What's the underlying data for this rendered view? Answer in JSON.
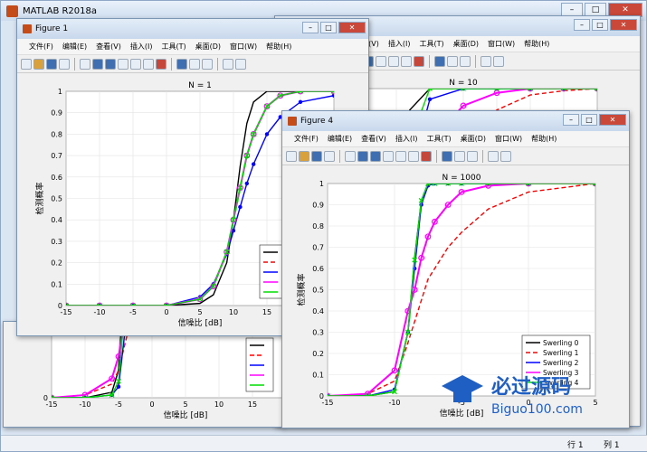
{
  "app": {
    "title": "MATLAB R2018a"
  },
  "status": {
    "row": "行 1",
    "col": "列 1"
  },
  "menus": [
    "文件(F)",
    "编辑(E)",
    "查看(V)",
    "插入(I)",
    "工具(T)",
    "桌面(D)",
    "窗口(W)",
    "帮助(H)"
  ],
  "fig1": {
    "title": "Figure 1"
  },
  "fig4": {
    "title": "Figure 4"
  },
  "watermark": {
    "main": "必过源码",
    "url": "Biguo100.com"
  },
  "colors": {
    "s0": "#000000",
    "s1": "#ff0000",
    "s2": "#0000ff",
    "s3": "#ff00ff",
    "s4": "#00dd00"
  },
  "chart_data": [
    {
      "type": "line",
      "title": "N = 1",
      "xlabel": "信噪比 [dB]",
      "ylabel": "检测概率",
      "xlim": [
        -15,
        25
      ],
      "ylim": [
        0,
        1
      ],
      "grid": true,
      "legend": "bottom-right",
      "x": [
        -15,
        -10,
        -5,
        0,
        5,
        7,
        9,
        10,
        11,
        12,
        13,
        15,
        17,
        20,
        25
      ],
      "series": [
        {
          "values": [
            0,
            0,
            0,
            0,
            0.01,
            0.05,
            0.2,
            0.4,
            0.65,
            0.85,
            0.95,
            1,
            1,
            1,
            1
          ]
        },
        {
          "values": [
            0,
            0,
            0,
            0,
            0.03,
            0.09,
            0.25,
            0.4,
            0.55,
            0.7,
            0.8,
            0.93,
            0.98,
            1,
            1
          ]
        },
        {
          "values": [
            0,
            0,
            0,
            0,
            0.04,
            0.1,
            0.24,
            0.35,
            0.46,
            0.57,
            0.66,
            0.8,
            0.88,
            0.95,
            0.98
          ]
        },
        {
          "values": [
            0,
            0,
            0,
            0,
            0.03,
            0.09,
            0.25,
            0.4,
            0.55,
            0.7,
            0.8,
            0.93,
            0.98,
            1,
            1
          ]
        },
        {
          "values": [
            0,
            0,
            0,
            0,
            0.03,
            0.09,
            0.25,
            0.4,
            0.55,
            0.7,
            0.8,
            0.93,
            0.98,
            1,
            1
          ]
        }
      ]
    },
    {
      "type": "line",
      "title": "N = 10",
      "xlabel": "信噪比 [dB]",
      "ylabel": "检测概率",
      "xlim": [
        -15,
        25
      ],
      "ylim": [
        0,
        1
      ],
      "grid": true,
      "legend": "bottom-right",
      "x": [
        -15,
        -10,
        -6,
        -5,
        -4,
        -3,
        0,
        5,
        10,
        15,
        20,
        25
      ],
      "series": [
        {
          "values": [
            0,
            0,
            0.02,
            0.1,
            0.5,
            0.9,
            1,
            1,
            1,
            1,
            1,
            1
          ]
        },
        {
          "values": [
            0,
            0.01,
            0.05,
            0.1,
            0.2,
            0.3,
            0.55,
            0.75,
            0.9,
            0.97,
            0.99,
            1
          ]
        },
        {
          "values": [
            0,
            0,
            0.01,
            0.04,
            0.25,
            0.6,
            0.95,
            1,
            1,
            1,
            1,
            1
          ]
        },
        {
          "values": [
            0,
            0.01,
            0.07,
            0.15,
            0.3,
            0.45,
            0.75,
            0.92,
            0.98,
            1,
            1,
            1
          ]
        },
        {
          "values": [
            0,
            0,
            0.01,
            0.06,
            0.35,
            0.75,
            1,
            1,
            1,
            1,
            1,
            1
          ]
        }
      ]
    },
    {
      "type": "line",
      "title": "N = 1000",
      "xlabel": "信噪比 [dB]",
      "ylabel": "检测概率",
      "xlim": [
        -15,
        5
      ],
      "ylim": [
        0,
        1
      ],
      "grid": true,
      "legend": "bottom-right",
      "x": [
        -15,
        -12,
        -10,
        -9,
        -8.5,
        -8,
        -7.5,
        -7,
        -6,
        -5,
        -3,
        0,
        5
      ],
      "series": [
        {
          "name": "Swerling 0",
          "values": [
            0,
            0,
            0.02,
            0.3,
            0.65,
            0.92,
            1,
            1,
            1,
            1,
            1,
            1,
            1
          ]
        },
        {
          "name": "Swerling 1",
          "values": [
            0,
            0.01,
            0.07,
            0.25,
            0.35,
            0.45,
            0.55,
            0.6,
            0.7,
            0.77,
            0.88,
            0.96,
            1
          ]
        },
        {
          "name": "Swerling 2",
          "values": [
            0,
            0,
            0.03,
            0.3,
            0.6,
            0.9,
            0.99,
            1,
            1,
            1,
            1,
            1,
            1
          ]
        },
        {
          "name": "Swerling 3",
          "values": [
            0,
            0.01,
            0.12,
            0.4,
            0.5,
            0.65,
            0.75,
            0.82,
            0.9,
            0.96,
            0.99,
            1,
            1
          ]
        },
        {
          "name": "Swerling 4",
          "values": [
            0,
            0,
            0.02,
            0.3,
            0.64,
            0.92,
            1,
            1,
            1,
            1,
            1,
            1,
            1
          ]
        }
      ]
    }
  ]
}
